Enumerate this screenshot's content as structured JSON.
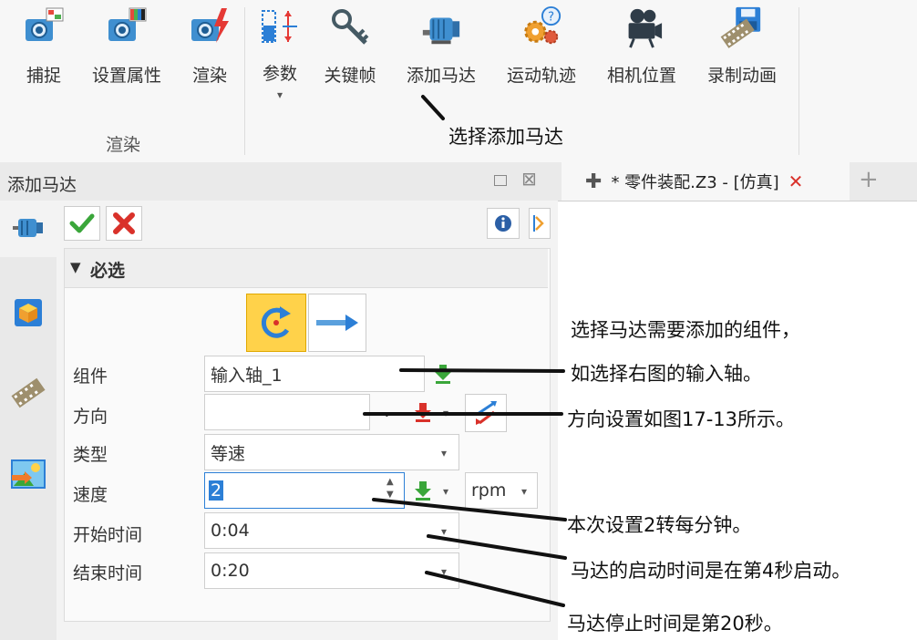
{
  "ribbon": {
    "buttons": [
      {
        "label": "捕捉",
        "icon": "camera-capture-icon"
      },
      {
        "label": "设置属性",
        "icon": "camera-properties-icon"
      },
      {
        "label": "渲染",
        "icon": "camera-render-icon"
      },
      {
        "label": "参数",
        "icon": "parameters-icon"
      },
      {
        "label": "关键帧",
        "icon": "key-icon"
      },
      {
        "label": "添加马达",
        "icon": "motor-icon"
      },
      {
        "label": "运动轨迹",
        "icon": "gears-help-icon"
      },
      {
        "label": "相机位置",
        "icon": "movie-camera-icon"
      },
      {
        "label": "录制动画",
        "icon": "film-save-icon"
      }
    ],
    "group_label": "渲染",
    "dropdown_glyph": "▾"
  },
  "panel": {
    "title": "添加马达",
    "section_title": "必选",
    "section_arrow": "▼",
    "labels": {
      "component": "组件",
      "direction": "方向",
      "type": "类型",
      "speed": "速度",
      "start_time": "开始时间",
      "end_time": "结束时间"
    },
    "values": {
      "component": "输入轴_1",
      "direction": "",
      "type": "等速",
      "speed": "2",
      "speed_unit": "rpm",
      "start_time": "0:04",
      "end_time": "0:20"
    }
  },
  "doc_tab": {
    "title": "* 零件装配.Z3 - [仿真]",
    "add_glyph": "+"
  },
  "annotations": {
    "ribbon_note": "选择添加马达",
    "component_note_1": "选择马达需要添加的组件，",
    "component_note_2": "如选择右图的输入轴。",
    "direction_note": "方向设置如图17-13所示。",
    "speed_note": "本次设置2转每分钟。",
    "start_note": "马达的启动时间是在第4秒启动。",
    "end_note": "马达停止时间是第20秒。"
  },
  "colors": {
    "ok_green": "#3aa63a",
    "cancel_red": "#d9312a",
    "selected_highlight": "#ffd24a",
    "accent_blue": "#2c7fd6"
  }
}
